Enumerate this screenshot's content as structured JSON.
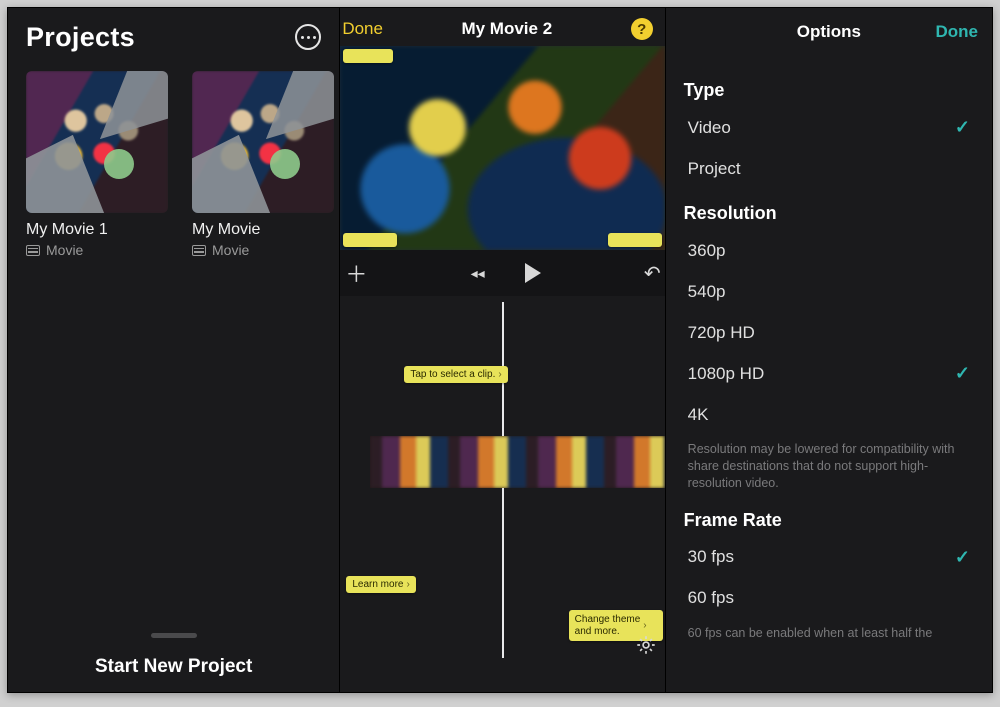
{
  "panel1": {
    "title": "Projects",
    "projects": [
      {
        "name": "My Movie 1",
        "type": "Movie"
      },
      {
        "name": "My Movie",
        "type": "Movie"
      }
    ],
    "start_new": "Start New Project"
  },
  "panel2": {
    "done": "Done",
    "title": "My Movie 2",
    "help": "?",
    "tip_select": "Tap to select a clip.",
    "tip_learn": "Learn more",
    "tip_theme_l1": "Change theme",
    "tip_theme_l2": "and more."
  },
  "panel3": {
    "title": "Options",
    "done": "Done",
    "sections": {
      "type": {
        "label": "Type",
        "items": [
          {
            "label": "Video",
            "selected": true
          },
          {
            "label": "Project",
            "selected": false
          }
        ]
      },
      "resolution": {
        "label": "Resolution",
        "items": [
          {
            "label": "360p",
            "selected": false
          },
          {
            "label": "540p",
            "selected": false
          },
          {
            "label": "720p HD",
            "selected": false
          },
          {
            "label": "1080p HD",
            "selected": true
          },
          {
            "label": "4K",
            "selected": false
          }
        ],
        "note": "Resolution may be lowered for compatibility with share destinations that do not support high-resolution video."
      },
      "framerate": {
        "label": "Frame Rate",
        "items": [
          {
            "label": "30 fps",
            "selected": true
          },
          {
            "label": "60 fps",
            "selected": false
          }
        ],
        "note": "60 fps can be enabled when at least half the"
      }
    }
  }
}
